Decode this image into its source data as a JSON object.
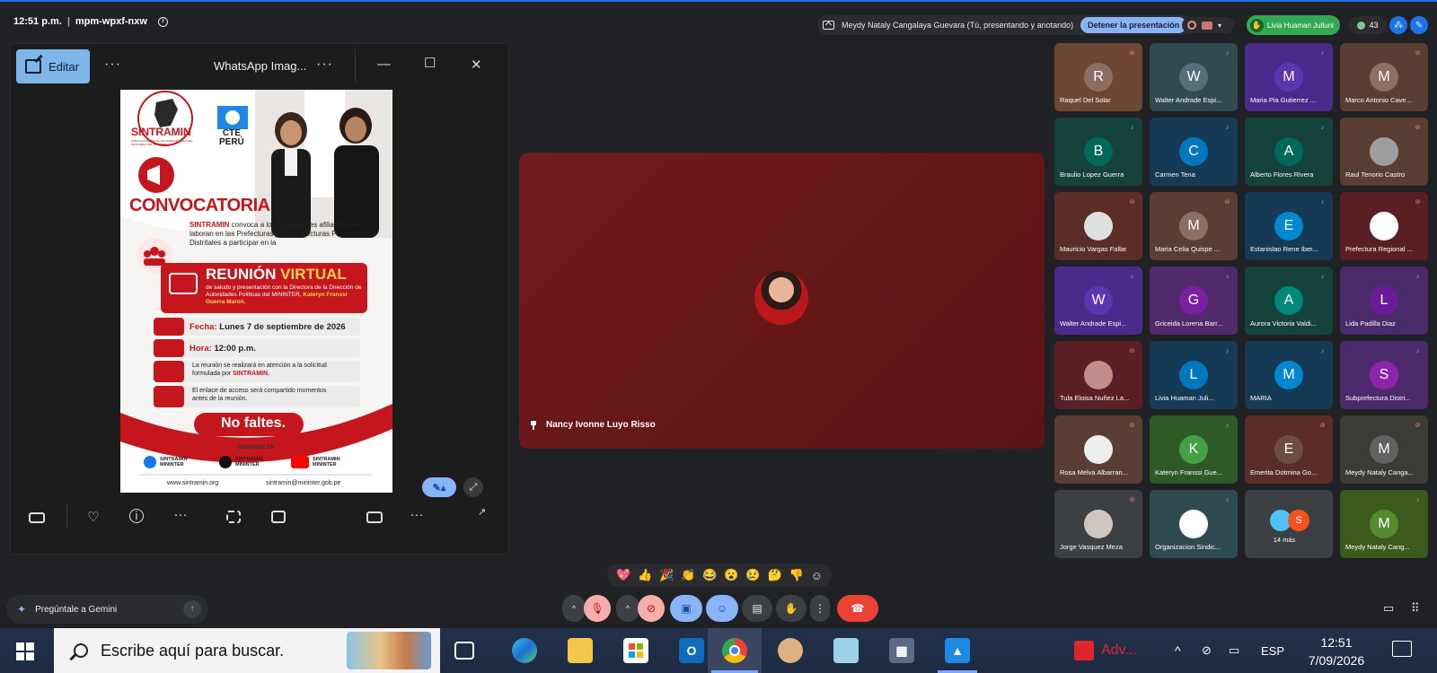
{
  "meeting": {
    "time": "12:51 p.m.",
    "code": "mpm-wpxf-nxw",
    "presenting_text": "Meydy Nataly Cangalaya Guevara (Tú, presentando y anotando)",
    "stop_presenting": "Detener la presentación",
    "host_chip": "Livia Huaman Julluni",
    "people_count": "43",
    "main_speaker": "Nancy Ivonne Luyo Risso"
  },
  "viewer": {
    "edit_label": "Editar",
    "title": "WhatsApp Imag...",
    "poster": {
      "org": "SINTRAMIN",
      "org_sub": "SINDICATO NACIONAL DE TRABAJADORES DEL MINISTERIO DEL INTERIOR",
      "cte": "CTE",
      "peru": "PERÚ",
      "heading": "CONVOCATORIA",
      "intro_org": "SINTRAMIN",
      "intro": " convoca a los trabajadores afiliados que laboran en las Prefecturas y Subprefecturas Provinciales y Distritales a participar en la",
      "reunion": "REUNIÓN",
      "virtual": "VIRTUAL",
      "reunion_sub": "de saludo y presentación con la Directora de la Dirección de Autoridades Políticas del MININTER,",
      "reunion_name": " Kateryn Franssi Guerra Maron.",
      "fecha_label": "Fecha:",
      "fecha": " Lunes 7 de septiembre de 2026",
      "hora_label": "Hora:",
      "hora": " 12:00 p.m.",
      "note1": "La reunión se realizará en atención a la solicitud formulada por ",
      "note1_org": "SINTRAMIN.",
      "note2": "El enlace de acceso será compartido momentos antes de la reunión.",
      "no_faltes": "No faltes.",
      "siguenos": "SÍGUENOS EN:",
      "social1": "SINTRAMIN MININTER",
      "social2": "SINTRAMIN MININTER",
      "social3": "SINTRAMIN MININTER",
      "web": "www.sintramin.org",
      "email": "sintramin@mininter.gob.pe"
    }
  },
  "participants": [
    {
      "name": "Raquel Del Solar",
      "initial": "R",
      "bg": "#6d4634",
      "av": "#8d6e63",
      "mic": "off"
    },
    {
      "name": "Walter Andrade Espi...",
      "initial": "W",
      "bg": "#2f4b4f",
      "av": "#546e7a",
      "mic": "on"
    },
    {
      "name": "Maria Pia Gutierrez ...",
      "initial": "M",
      "bg": "#4a2a8a",
      "av": "#5e35b1",
      "mic": "on"
    },
    {
      "name": "Marco Antonio Cave...",
      "initial": "M",
      "bg": "#5a3d33",
      "av": "#8d6e63",
      "mic": "off"
    },
    {
      "name": "Braulio Lopez Guerra",
      "initial": "B",
      "bg": "#15433c",
      "av": "#00695c",
      "mic": "on"
    },
    {
      "name": "Carmen Tena",
      "initial": "C",
      "bg": "#143a55",
      "av": "#0277bd",
      "mic": "on"
    },
    {
      "name": "Alberto Flores Rivera",
      "initial": "A",
      "bg": "#15433c",
      "av": "#00695c",
      "mic": "on"
    },
    {
      "name": "Raul Tenorio Castro",
      "initial": "",
      "bg": "#5a3d33",
      "av": "#9e9e9e",
      "mic": "off"
    },
    {
      "name": "Mauricio Vargas Fallar",
      "initial": "",
      "bg": "#5a2e26",
      "av": "#e0e0e0",
      "mic": "off"
    },
    {
      "name": "Maria Celia Quispe ...",
      "initial": "M",
      "bg": "#5a3d33",
      "av": "#8d6e63",
      "mic": "off"
    },
    {
      "name": "Estanislao Rene Iber...",
      "initial": "E",
      "bg": "#143a55",
      "av": "#0288d1",
      "mic": "on"
    },
    {
      "name": "Prefectura Regional ...",
      "initial": "",
      "bg": "#5a1f24",
      "av": "#ffffff",
      "mic": "off"
    },
    {
      "name": "Walter Andrade Espi...",
      "initial": "W",
      "bg": "#4a2a8a",
      "av": "#5e35b1",
      "mic": "on"
    },
    {
      "name": "Griceida Lorena Barr...",
      "initial": "G",
      "bg": "#512a6b",
      "av": "#7b1fa2",
      "mic": "on"
    },
    {
      "name": "Aurora Victoria Valdi...",
      "initial": "A",
      "bg": "#15433c",
      "av": "#00897b",
      "mic": "on"
    },
    {
      "name": "Lida Padilla Diaz",
      "initial": "L",
      "bg": "#4a2a6b",
      "av": "#6a1b9a",
      "mic": "on"
    },
    {
      "name": "Tula Eloisa Nuñez La...",
      "initial": "",
      "bg": "#5a1f24",
      "av": "#c48b8b",
      "mic": "off"
    },
    {
      "name": "Livia Huaman Juli...",
      "initial": "L",
      "bg": "#143a55",
      "av": "#0277bd",
      "mic": "on"
    },
    {
      "name": "MARIA",
      "initial": "M",
      "bg": "#143a55",
      "av": "#0288d1",
      "mic": "on"
    },
    {
      "name": "Subprefectura Distri...",
      "initial": "S",
      "bg": "#4a2a6b",
      "av": "#8e24aa",
      "mic": "on"
    },
    {
      "name": "Rosa Melva Albarran...",
      "initial": "",
      "bg": "#5a3d33",
      "av": "#eeeeee",
      "mic": "off"
    },
    {
      "name": "Kateryn Franssi Gue...",
      "initial": "K",
      "bg": "#2f5a28",
      "av": "#43a047",
      "mic": "on"
    },
    {
      "name": "Emerita Dotmina Go...",
      "initial": "E",
      "bg": "#5a2e26",
      "av": "#6d4c41",
      "mic": "off"
    },
    {
      "name": "Meydy Nataly Canga...",
      "initial": "M",
      "bg": "#3c3b36",
      "av": "#616161",
      "mic": "off"
    },
    {
      "name": "Jorge Vasquez Meza",
      "initial": "",
      "bg": "#3c4043",
      "av": "#cfc6c0",
      "mic": "off"
    },
    {
      "name": "Organizacion Sindic...",
      "initial": "",
      "bg": "#2f4b4f",
      "av": "#ffffff",
      "mic": "on"
    },
    {
      "name": "14 más",
      "initial": "S",
      "bg": "#3c4043",
      "av": "#f4511e",
      "mic": "none"
    },
    {
      "name": "Meydy Nataly Cang...",
      "initial": "M",
      "bg": "#3d5a1e",
      "av": "#558b2f",
      "mic": "on"
    }
  ],
  "reactions": [
    "💖",
    "👍",
    "🎉",
    "👏",
    "😂",
    "😮",
    "😢",
    "🤔",
    "👎",
    "☺"
  ],
  "controls": {
    "gemini": "Pregúntale a Gemini"
  },
  "taskbar": {
    "search_placeholder": "Escribe aquí para buscar.",
    "adobe": "Adv...",
    "lang": "ESP",
    "time": "12:51",
    "date": "7/09/2026"
  }
}
